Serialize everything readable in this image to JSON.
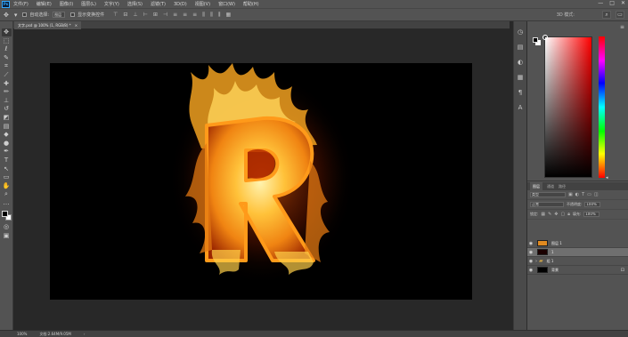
{
  "app": {
    "logo": "Ps"
  },
  "menubar": {
    "items": [
      "文件(F)",
      "编辑(E)",
      "图像(I)",
      "图层(L)",
      "文字(Y)",
      "选择(S)",
      "滤镜(T)",
      "3D(D)",
      "视图(V)",
      "窗口(W)",
      "帮助(H)"
    ],
    "window_controls": [
      "—",
      "□",
      "✕"
    ]
  },
  "options_bar": {
    "auto_select_label": "自动选择:",
    "auto_select_value": "图层",
    "transform_label": "显示变换控件",
    "mode_3d_label": "3D 模式:"
  },
  "document_tab": {
    "title": "文字.psd @ 100% (1, RGB/8) *",
    "close": "×"
  },
  "layers_panel": {
    "tabs": [
      "图层",
      "通道",
      "路径"
    ],
    "kind_filter": "类型",
    "blend_mode": "正常",
    "opacity_label": "不透明度:",
    "opacity_value": "100%",
    "lock_label": "锁定:",
    "fill_label": "填充:",
    "fill_value": "100%",
    "layers": [
      {
        "name": "图层 1",
        "type": "layer",
        "thumb_color": "#e08a20",
        "selected": false
      },
      {
        "name": "1",
        "type": "layer",
        "thumb_color": "#1a0000",
        "selected": true
      },
      {
        "name": "组 1",
        "type": "group",
        "thumb_color": "",
        "selected": false
      },
      {
        "name": "背景",
        "type": "background",
        "thumb_color": "#000000",
        "selected": false
      }
    ]
  },
  "status_bar": {
    "zoom": "100%",
    "doc_info": "文档:2.64M/9.05M"
  },
  "colors": {
    "foreground": "#000000",
    "background": "#ffffff",
    "picker_hue": "#ff0000"
  }
}
